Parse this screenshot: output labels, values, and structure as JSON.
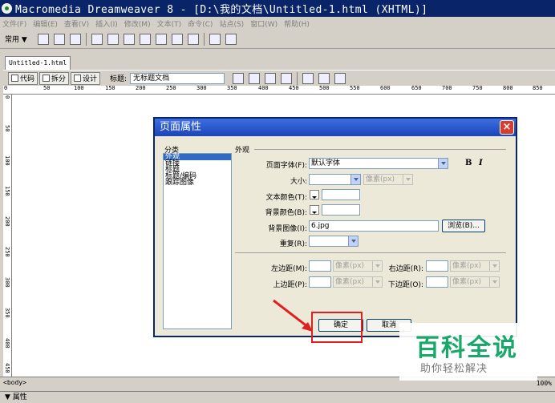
{
  "window": {
    "title": "Macromedia Dreamweaver 8 - [D:\\我的文档\\Untitled-1.html (XHTML)]"
  },
  "menu": [
    "文件(F)",
    "编辑(E)",
    "查看(V)",
    "插入(I)",
    "修改(M)",
    "文本(T)",
    "命令(C)",
    "站点(S)",
    "窗口(W)",
    "帮助(H)"
  ],
  "insert_bar": {
    "category": "常用 ▼"
  },
  "document": {
    "tab": "Untitled-1.html",
    "views": {
      "code": "代码",
      "split": "拆分",
      "design": "设计"
    },
    "title_label": "标题:",
    "title_value": "无标题文档"
  },
  "ruler": {
    "h_ticks": [
      "0",
      "50",
      "100",
      "150",
      "200",
      "250",
      "300",
      "350",
      "400",
      "450",
      "500",
      "550",
      "600",
      "650",
      "700",
      "750",
      "800",
      "850"
    ],
    "v_ticks": [
      "0",
      "50",
      "100",
      "150",
      "200",
      "250",
      "300",
      "350",
      "400",
      "450"
    ]
  },
  "status": {
    "tag": "<body>",
    "zoom": "100%"
  },
  "properties": {
    "label": "▼ 属性"
  },
  "dialog": {
    "title": "页面属性",
    "category_label": "分类",
    "categories": [
      "外观",
      "链接",
      "标题",
      "标题/编码",
      "跟踪图像"
    ],
    "section": "外观",
    "font_label": "页面字体(F):",
    "font_value": "默认字体",
    "bold": "B",
    "italic": "I",
    "size_label": "大小:",
    "size_unit": "像素(px)",
    "text_color_label": "文本颜色(T):",
    "bg_color_label": "背景颜色(B):",
    "bg_image_label": "背景图像(I):",
    "bg_image_value": "6.jpg",
    "browse": "浏览(B)...",
    "repeat_label": "重复(R):",
    "left_margin_label": "左边距(M):",
    "right_margin_label": "右边距(R):",
    "top_margin_label": "上边距(P):",
    "bottom_margin_label": "下边距(O):",
    "unit": "像素(px)",
    "ok": "确定",
    "cancel": "取消"
  },
  "watermark": {
    "title": "百科全说",
    "subtitle": "助你轻松解决"
  }
}
